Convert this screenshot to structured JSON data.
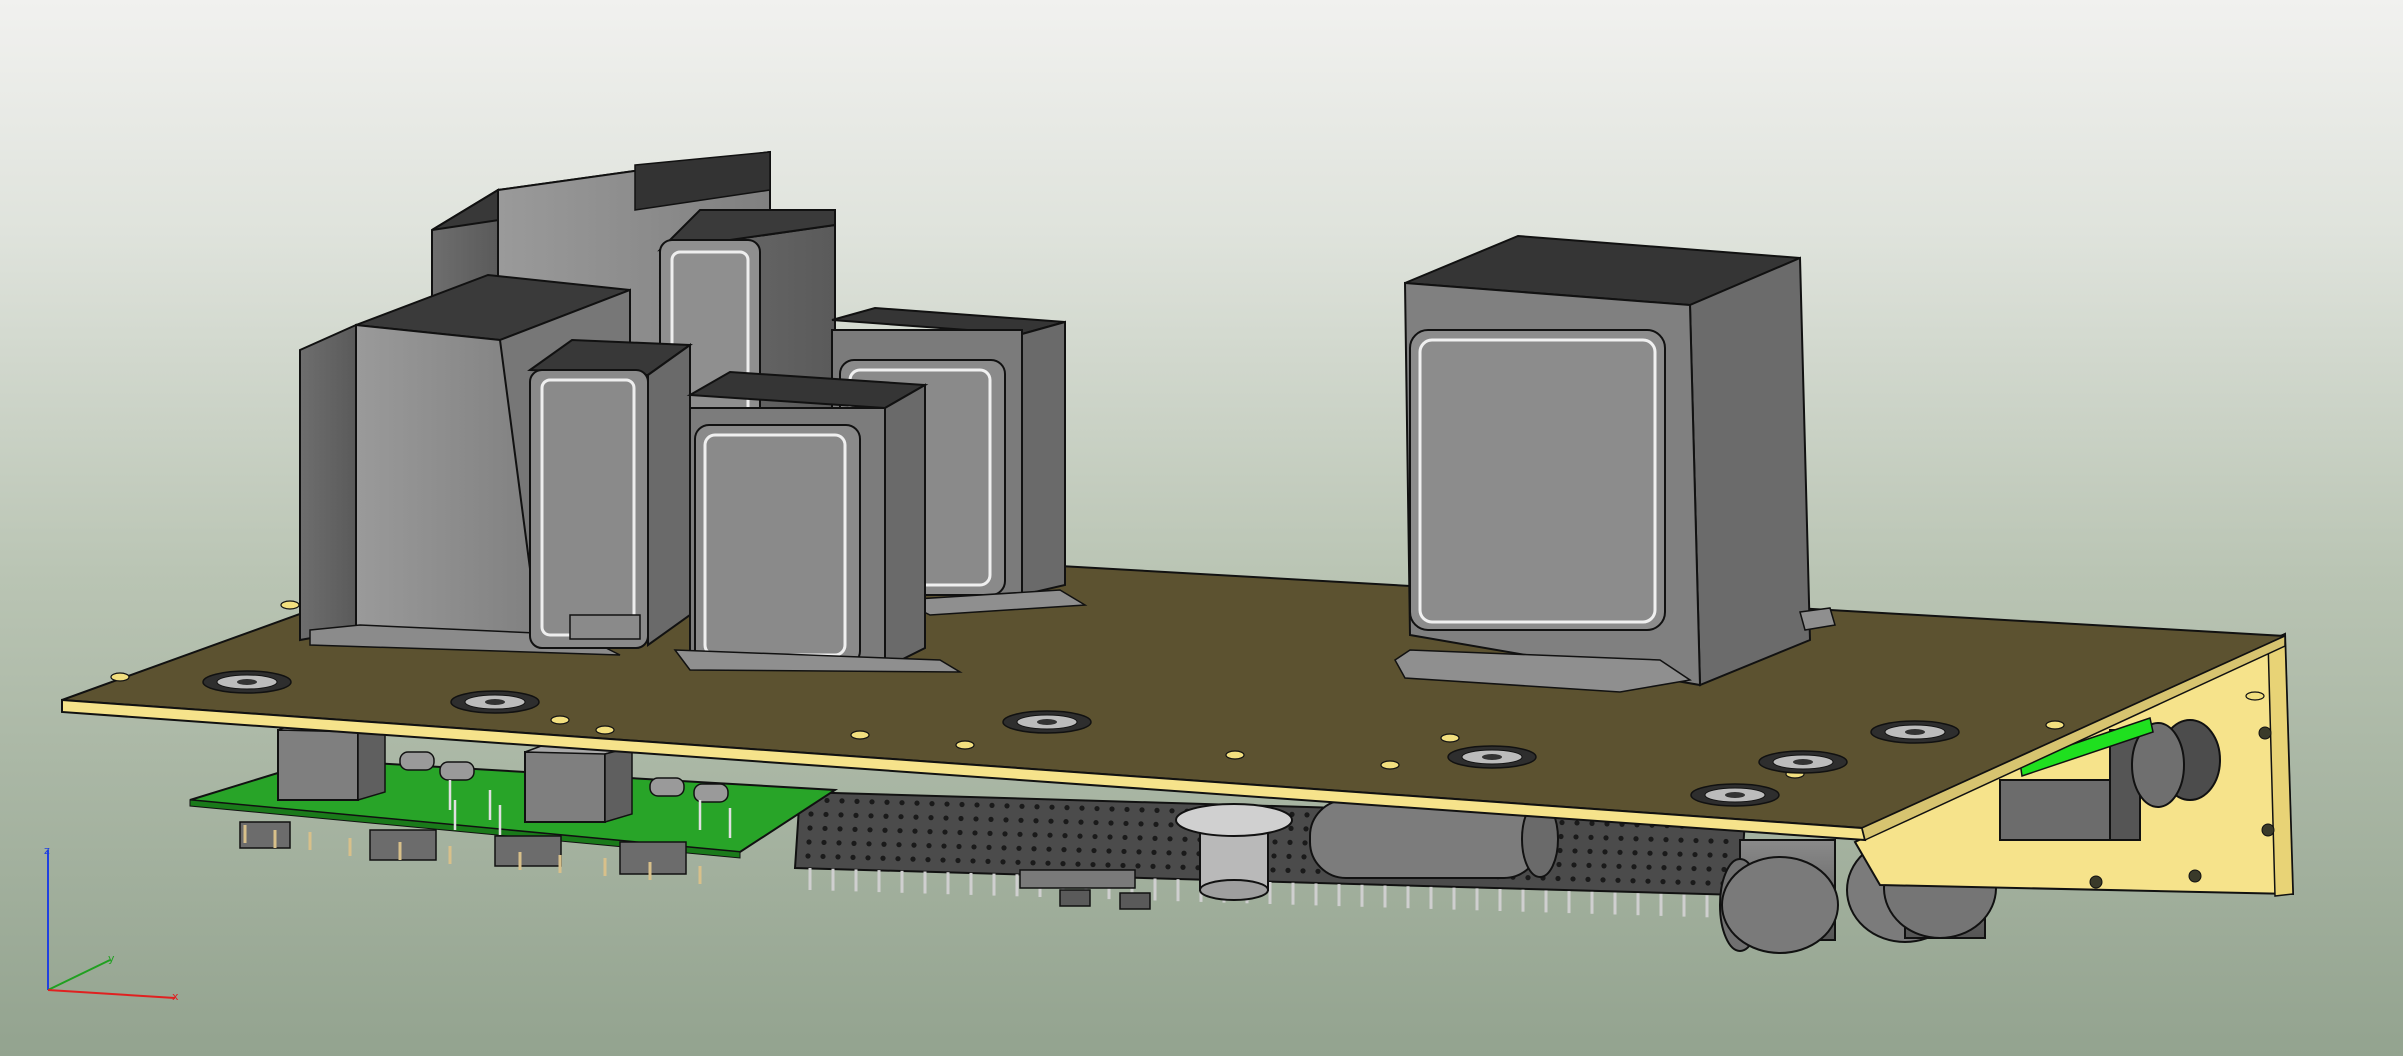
{
  "viewport": {
    "background_top": "#f1f1ef",
    "background_bottom": "#93a38f"
  },
  "model": {
    "chassis_top_color": "#5c5230",
    "chassis_edge_color": "#f7e48a",
    "pcb_color": "#2aa52a",
    "pcb_highlight": "#1fe01f",
    "transformer_color": "#8a8a8a",
    "transformer_top_color": "#3c3c3c",
    "perfboard_color": "#4a4a4a",
    "capacitor_color": "#6a6a6a"
  },
  "axis_triad": {
    "x_label": "x",
    "y_label": "y",
    "z_label": "z",
    "x_color": "#e02020",
    "y_color": "#20a020",
    "z_color": "#2040e0"
  }
}
